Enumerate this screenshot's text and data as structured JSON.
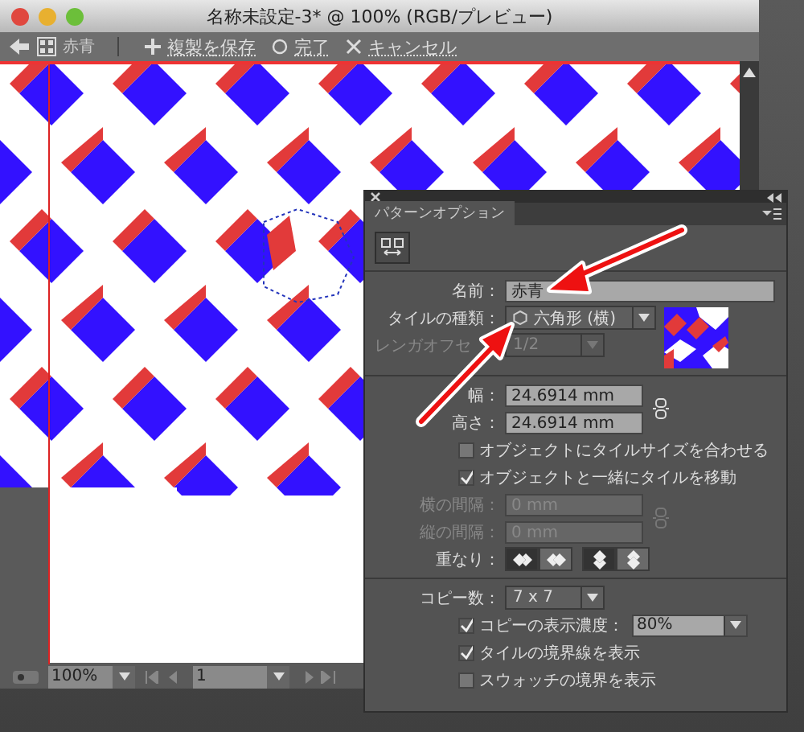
{
  "window": {
    "title": "名称未設定-3* @ 100% (RGB/プレビュー)"
  },
  "toolbar": {
    "swatch_name": "赤青",
    "actions": [
      {
        "kind": "plus",
        "label": "複製を保存"
      },
      {
        "kind": "done",
        "label": "完了"
      },
      {
        "kind": "cancel",
        "label": "キャンセル"
      }
    ]
  },
  "panel": {
    "tab": "パターンオプション",
    "name": {
      "label": "名前：",
      "value": "赤青"
    },
    "tile_type": {
      "label": "タイルの種類：",
      "value": "六角形 (横)"
    },
    "brick_offset": {
      "label": "レンガオフセ",
      "value": "1/2",
      "disabled": true
    },
    "width": {
      "label": "幅：",
      "value": "24.6914 mm"
    },
    "height": {
      "label": "高さ：",
      "value": "24.6914 mm"
    },
    "size_options": [
      {
        "label": "オブジェクトにタイルサイズを合わせる",
        "checked": false
      },
      {
        "label": "オブジェクトと一緒にタイルを移動",
        "checked": true
      }
    ],
    "h_spacing": {
      "label": "横の間隔：",
      "value": "0 mm",
      "disabled": true
    },
    "v_spacing": {
      "label": "縦の間隔：",
      "value": "0 mm",
      "disabled": true
    },
    "overlap": {
      "label": "重なり：",
      "buttons": [
        {
          "kind": "left",
          "selected": true
        },
        {
          "kind": "right",
          "selected": false
        },
        {
          "kind": "top",
          "selected": true
        },
        {
          "kind": "bottom",
          "selected": false
        }
      ]
    },
    "copies": {
      "label": "コピー数：",
      "value": "7 x 7"
    },
    "copy_options": [
      {
        "kind": "opacity",
        "label": "コピーの表示濃度：",
        "checked": true,
        "value": "80%"
      },
      {
        "kind": "plain",
        "label": "タイルの境界線を表示",
        "checked": true
      },
      {
        "kind": "plain",
        "label": "スウォッチの境界を表示",
        "checked": false
      }
    ]
  },
  "status_bar": {
    "zoom": "100%",
    "page": "1"
  }
}
